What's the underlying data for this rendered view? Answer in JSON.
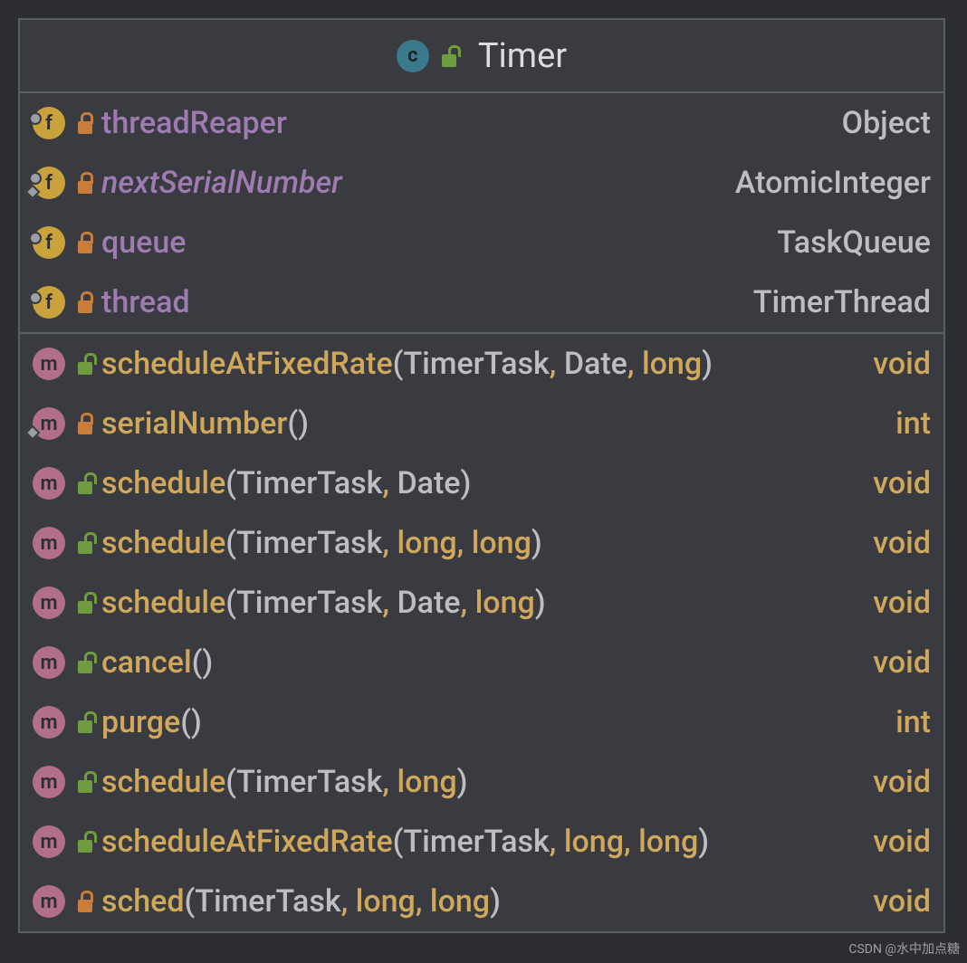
{
  "header": {
    "class_name": "Timer",
    "icon_letter": "c"
  },
  "fields": [
    {
      "name": "threadReaper",
      "type": "Object",
      "static_top": true,
      "static_bottom": false,
      "italic": false
    },
    {
      "name": "nextSerialNumber",
      "type": "AtomicInteger",
      "static_top": true,
      "static_bottom": true,
      "italic": true
    },
    {
      "name": "queue",
      "type": "TaskQueue",
      "static_top": true,
      "static_bottom": false,
      "italic": false
    },
    {
      "name": "thread",
      "type": "TimerThread",
      "static_top": true,
      "static_bottom": false,
      "italic": false
    }
  ],
  "methods": [
    {
      "name": "scheduleAtFixedRate",
      "return_type": "void",
      "visibility": "public",
      "static_bottom": false,
      "params": [
        {
          "text": "TimerTask",
          "primitive": false
        },
        {
          "text": "Date",
          "primitive": false
        },
        {
          "text": "long",
          "primitive": true
        }
      ]
    },
    {
      "name": "serialNumber",
      "return_type": "int",
      "visibility": "private",
      "static_bottom": true,
      "params": []
    },
    {
      "name": "schedule",
      "return_type": "void",
      "visibility": "public",
      "static_bottom": false,
      "params": [
        {
          "text": "TimerTask",
          "primitive": false
        },
        {
          "text": "Date",
          "primitive": false
        }
      ]
    },
    {
      "name": "schedule",
      "return_type": "void",
      "visibility": "public",
      "static_bottom": false,
      "params": [
        {
          "text": "TimerTask",
          "primitive": false
        },
        {
          "text": "long",
          "primitive": true
        },
        {
          "text": "long",
          "primitive": true
        }
      ]
    },
    {
      "name": "schedule",
      "return_type": "void",
      "visibility": "public",
      "static_bottom": false,
      "params": [
        {
          "text": "TimerTask",
          "primitive": false
        },
        {
          "text": "Date",
          "primitive": false
        },
        {
          "text": "long",
          "primitive": true
        }
      ]
    },
    {
      "name": "cancel",
      "return_type": "void",
      "visibility": "public",
      "static_bottom": false,
      "params": []
    },
    {
      "name": "purge",
      "return_type": "int",
      "visibility": "public",
      "static_bottom": false,
      "params": []
    },
    {
      "name": "schedule",
      "return_type": "void",
      "visibility": "public",
      "static_bottom": false,
      "params": [
        {
          "text": "TimerTask",
          "primitive": false
        },
        {
          "text": "long",
          "primitive": true
        }
      ]
    },
    {
      "name": "scheduleAtFixedRate",
      "return_type": "void",
      "visibility": "public",
      "static_bottom": false,
      "params": [
        {
          "text": "TimerTask",
          "primitive": false
        },
        {
          "text": "long",
          "primitive": true
        },
        {
          "text": "long",
          "primitive": true
        }
      ]
    },
    {
      "name": "sched",
      "return_type": "void",
      "visibility": "private",
      "static_bottom": false,
      "params": [
        {
          "text": "TimerTask",
          "primitive": false
        },
        {
          "text": "long",
          "primitive": true
        },
        {
          "text": "long",
          "primitive": true
        }
      ]
    }
  ],
  "watermark": "CSDN @水中加点糖"
}
